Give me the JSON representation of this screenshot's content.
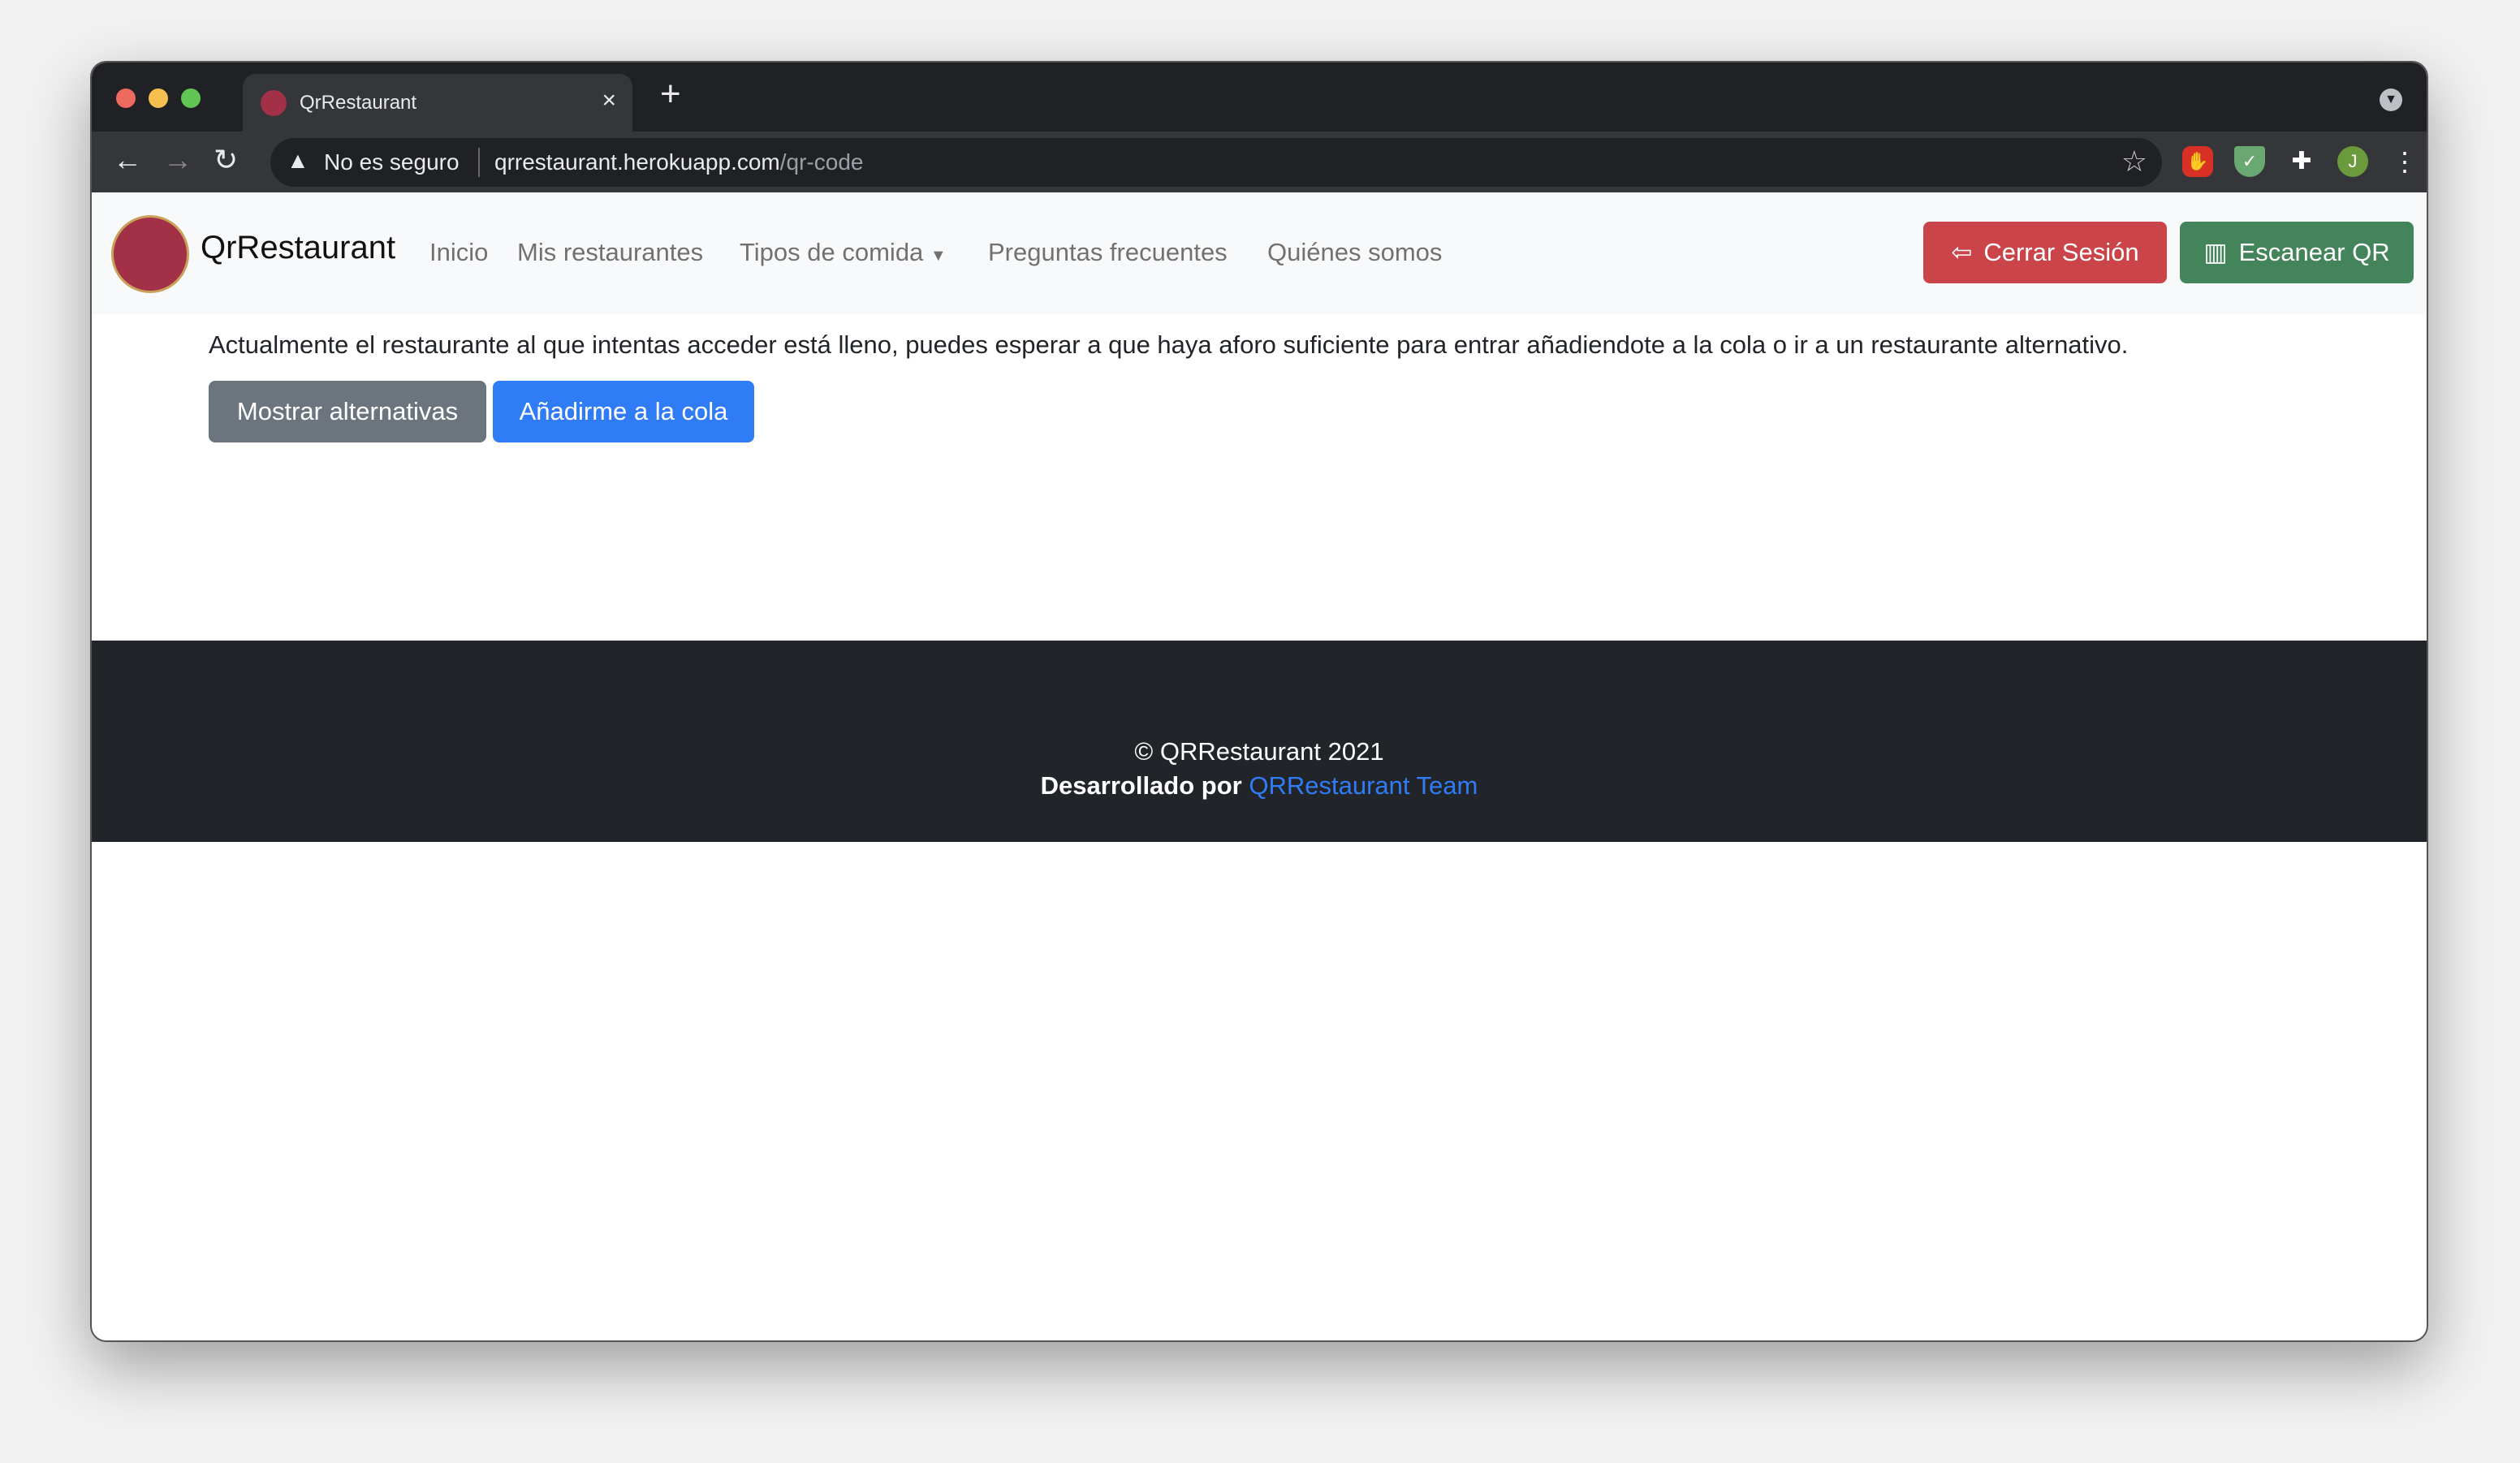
{
  "browser": {
    "tab_title": "QrRestaurant",
    "security_label": "No es seguro",
    "url_host": "qrrestaurant.herokuapp.com",
    "url_path": "/qr-code",
    "profile_initial": "J"
  },
  "navbar": {
    "brand": "QrRestaurant",
    "links": [
      "Inicio",
      "Mis restaurantes",
      "Tipos de comida",
      "Preguntas frecuentes",
      "Quiénes somos"
    ],
    "logout": "Cerrar Sesión",
    "scan": "Escanear QR"
  },
  "main": {
    "message": "Actualmente el restaurante al que intentas acceder está lleno, puedes esperar a que haya aforo suficiente para entrar añadiendote a la cola o ir a un restaurante alternativo.",
    "show_alternatives": "Mostrar alternativas",
    "join_queue": "Añadirme a la cola"
  },
  "footer": {
    "copyright": "© QRRestaurant 2021",
    "developed_by": "Desarrollado por",
    "team_link": "QRRestaurant Team"
  },
  "colors": {
    "danger": "#cb444a",
    "success": "#43845a",
    "primary": "#2f7cf6",
    "secondary": "#6c757d",
    "footer": "#212529"
  }
}
